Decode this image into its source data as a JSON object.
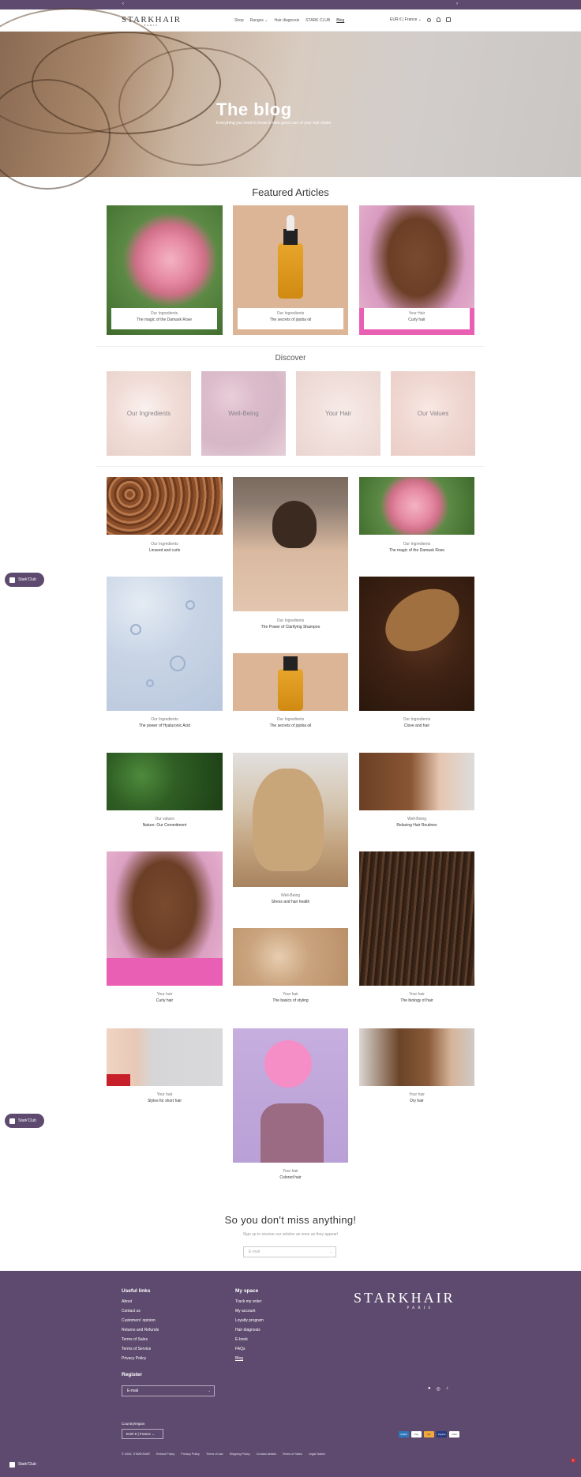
{
  "header": {
    "logo": "STARKHAIR",
    "logo_sub": "PARIS",
    "nav": [
      "Shop",
      "Ranges",
      "Hair diagnosis",
      "STARK CLUB",
      "Blog"
    ],
    "currency": "EUR € | France"
  },
  "hero": {
    "title": "The blog",
    "subtitle": "Everything you need to know to take good care of your hair mister"
  },
  "featured": {
    "title": "Featured Articles",
    "items": [
      {
        "category": "Our Ingredients",
        "title": "The magic of the Damask Rose"
      },
      {
        "category": "Our Ingredients",
        "title": "The secrets of jojoba oil"
      },
      {
        "category": "Your Hair",
        "title": "Curly hair"
      }
    ]
  },
  "discover": {
    "title": "Discover",
    "items": [
      "Our Ingredients",
      "Well-Being",
      "Your Hair",
      "Our Values"
    ]
  },
  "articles": [
    {
      "category": "Our Ingredients",
      "title": "Linseed and curls"
    },
    {
      "category": "Our Ingredients",
      "title": "The Power of Clarifying Shampoo"
    },
    {
      "category": "Our Ingredients",
      "title": "The magic of the Damask Rose"
    },
    {
      "category": "Our Ingredients",
      "title": "The power of Hyaluronic Acid"
    },
    {
      "category": "Our Ingredients",
      "title": "The secrets of jojoba oil"
    },
    {
      "category": "Our Ingredients",
      "title": "Clove and hair"
    },
    {
      "category": "Our values",
      "title": "Nature: Our Commitment"
    },
    {
      "category": "Well-Being",
      "title": "Stress and hair health"
    },
    {
      "category": "Well-Being",
      "title": "Relaxing Hair Routines"
    },
    {
      "category": "Your hair",
      "title": "Curly hair"
    },
    {
      "category": "Your hair",
      "title": "The basics of styling"
    },
    {
      "category": "Your hair",
      "title": "The biology of hair"
    },
    {
      "category": "Your hair",
      "title": "Styles for short hair"
    },
    {
      "category": "Your hair",
      "title": "Colored hair"
    },
    {
      "category": "Your hair",
      "title": "Dry hair"
    }
  ],
  "club_label": "Stark'Club",
  "newsletter": {
    "title": "So you don't miss anything!",
    "subtitle": "Sign up to receive our articles as soon as they appear!",
    "placeholder": "E-mail"
  },
  "footer": {
    "useful_title": "Useful links",
    "useful_links": [
      "About",
      "Contact us",
      "Customers' opinion",
      "Returns and Refunds",
      "Terms of Sales",
      "Terms of Service",
      "Privacy Policy"
    ],
    "space_title": "My space",
    "space_links": [
      "Track my order",
      "My account",
      "Loyalty program",
      "Hair diagnosis",
      "E-book",
      "FAQs",
      "Blog"
    ],
    "logo": "STARKHAIR",
    "logo_sub": "PARIS",
    "register_title": "Register",
    "register_placeholder": "E-mail",
    "country_label": "Country/region",
    "country_value": "EUR € | France",
    "payments": [
      "AMEX",
      "Pay",
      "MC",
      "PayPal",
      "VISA"
    ],
    "legal": [
      "© 2025, STARKHAIR",
      "Refund Policy",
      "Privacy Policy",
      "Terms of use",
      "Shipping Policy",
      "Contact details",
      "Terms of Sales",
      "Legal Notice"
    ]
  }
}
